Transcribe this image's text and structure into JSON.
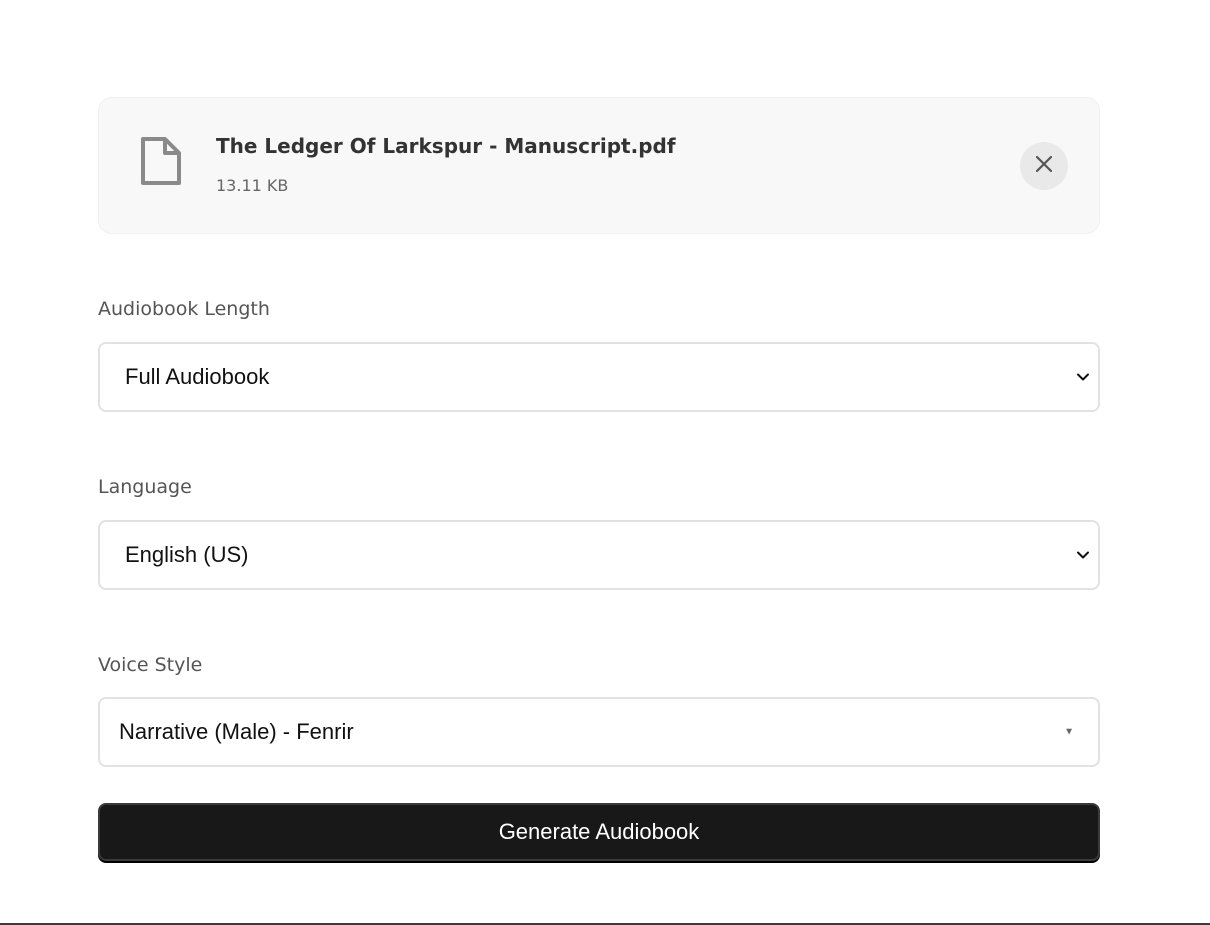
{
  "file": {
    "icon": "document-icon",
    "name": "The Ledger Of Larkspur - Manuscript.pdf",
    "size": "13.11 KB",
    "remove_icon": "close-icon"
  },
  "audiobook_length": {
    "label": "Audiobook Length",
    "selected": "Full Audiobook"
  },
  "language": {
    "label": "Language",
    "selected": "English (US)"
  },
  "voice_style": {
    "label": "Voice Style",
    "selected": "Narrative (Male) - Fenrir"
  },
  "generate_button": {
    "label": "Generate Audiobook",
    "color": "#181818"
  }
}
